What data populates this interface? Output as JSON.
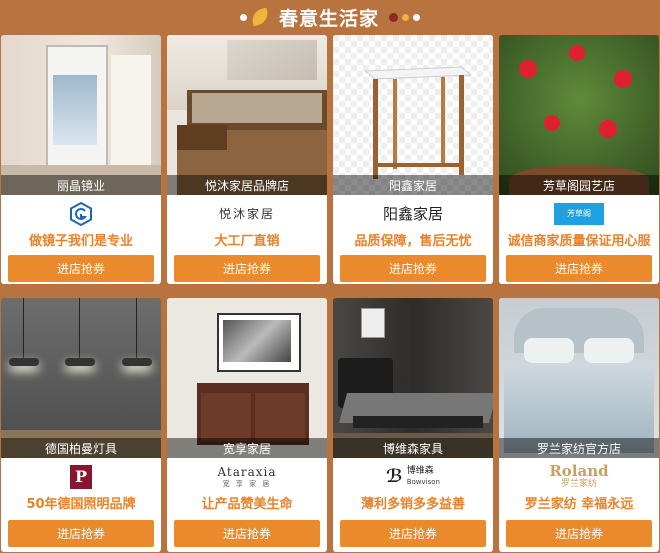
{
  "header": {
    "title": "春意生活家"
  },
  "colors": {
    "background": "#b8733f",
    "accent": "#e8822a",
    "button": "#ea8a2c"
  },
  "stores": [
    {
      "name": "丽晶镜业",
      "logo_text": "",
      "logo_icon": "hexagon-logo-icon",
      "slogan": "做镜子我们是专业",
      "button": "进店抢券"
    },
    {
      "name": "悦沐家居品牌店",
      "logo_text": "悦沐家居",
      "logo_icon": "",
      "slogan": "大工厂直销",
      "button": "进店抢券"
    },
    {
      "name": "阳鑫家居",
      "logo_text": "阳鑫家居",
      "logo_icon": "",
      "slogan": "品质保障，售后无忧",
      "button": "进店抢券"
    },
    {
      "name": "芳草阁园艺店",
      "logo_text": "芳草阁",
      "logo_icon": "",
      "slogan": "诚信商家质量保证用心服",
      "button": "进店抢券"
    },
    {
      "name": "德国柏曼灯具",
      "logo_text": "P",
      "logo_icon": "",
      "slogan": "50年德国照明品牌",
      "button": "进店抢券"
    },
    {
      "name": "宽享家居",
      "logo_text": "Ataraxia",
      "logo_sub": "宽 享 家 居",
      "logo_icon": "",
      "slogan": "让产品赞美生命",
      "button": "进店抢券"
    },
    {
      "name": "博维森家具",
      "logo_text": "博维森",
      "logo_sub": "Bowvison",
      "logo_icon": "",
      "slogan": "薄利多销多多益善",
      "button": "进店抢券"
    },
    {
      "name": "罗兰家纺官方店",
      "logo_text": "Roland",
      "logo_sub": "罗兰家纺",
      "logo_icon": "",
      "slogan": "罗兰家纺 幸福永远",
      "button": "进店抢券"
    }
  ]
}
